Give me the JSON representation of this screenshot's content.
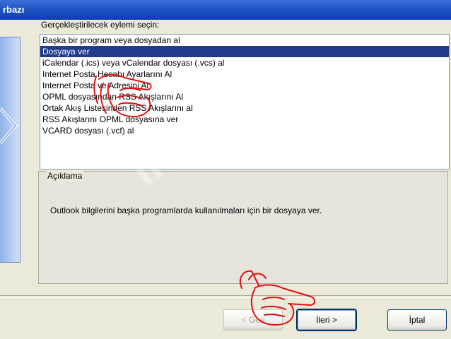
{
  "window": {
    "title": "rbazı"
  },
  "prompt": "Gerçekleştirilecek eylemi seçin:",
  "actions": [
    {
      "label": "Başka bir program veya dosyadan al",
      "selected": false
    },
    {
      "label": "Dosyaya ver",
      "selected": true
    },
    {
      "label": "iCalendar (.ics) veya vCalendar dosyası (.vcs) al",
      "selected": false
    },
    {
      "label": "Internet Posta Hesabı Ayarlarını Al",
      "selected": false
    },
    {
      "label": "Internet Posta ve Adresini Al",
      "selected": false
    },
    {
      "label": "OPML dosyasından RSS Akışlarını Al",
      "selected": false
    },
    {
      "label": "Ortak Akış Listesinden RSS Akışlarını al",
      "selected": false
    },
    {
      "label": "RSS Akışlarını OPML dosyasına ver",
      "selected": false
    },
    {
      "label": "VCARD dosyası (.vcf) al",
      "selected": false
    }
  ],
  "description": {
    "legend": "Açıklama",
    "text": "Outlook bilgilerini başka programlarda kullanılmaları için bir dosyaya ver."
  },
  "buttons": {
    "back": "< Geri",
    "next": "İleri >",
    "cancel": "İptal"
  },
  "watermark": "interbim",
  "annotation_color": "#e01010"
}
